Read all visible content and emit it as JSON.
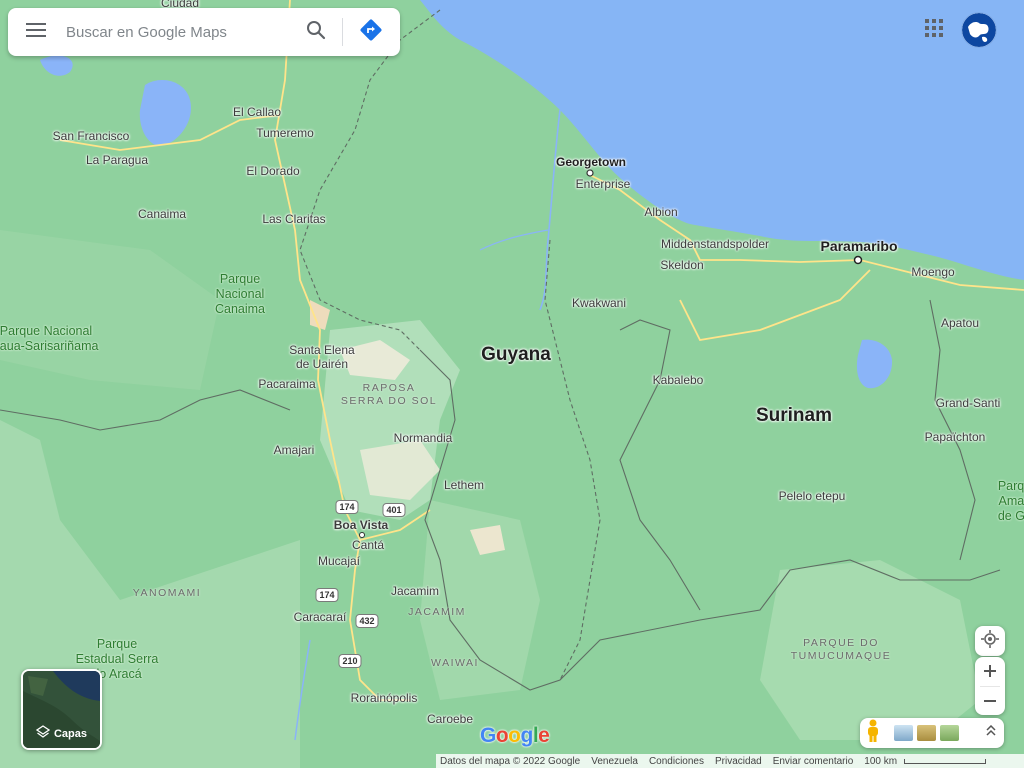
{
  "search": {
    "placeholder": "Buscar en Google Maps"
  },
  "icons": {
    "menu": "menu-icon",
    "search": "search-icon",
    "directions": "directions-icon",
    "apps": "apps-grid-icon",
    "locate": "my-location-icon",
    "pegman": "pegman-icon",
    "layers": "layers-icon",
    "expand": "chevron-up-icon"
  },
  "colors": {
    "land": "#8fd19e",
    "park": "#a8dbb0",
    "ocean": "#86b5f5",
    "water": "#8ab4f8",
    "road": "#ffe48a",
    "border": "#5f6d63"
  },
  "map": {
    "countries": [
      {
        "name": "Guyana"
      },
      {
        "name": "Surinam"
      }
    ],
    "cities": [
      {
        "name": "Georgetown"
      },
      {
        "name": "Paramaribo"
      }
    ],
    "towns": [
      "Ciudad",
      "El Callao",
      "Tumeremo",
      "San Francisco",
      "La Paragua",
      "El Dorado",
      "Canaima",
      "Las Claritas",
      "Santa Elena",
      "de Uairén",
      "Pacaraima",
      "Amajari",
      "Normandia",
      "Lethem",
      "Boa Vista",
      "Cantá",
      "Mucajaí",
      "Jacamim",
      "Caracaraí",
      "Rorainópolis",
      "Caroebe",
      "Enterprise",
      "Albion",
      "Middenstandspolder",
      "Skeldon",
      "Kwakwani",
      "Kabalebo",
      "Moengo",
      "Apatou",
      "Grand-Santi",
      "Papaïchton",
      "Pelelo etepu"
    ],
    "parks": [
      "Parque\nNacional\nCanaima",
      "Parque Nacional\nJaua-Sarisariñama",
      "Parque\nEstadual Serra\ndo Aracá",
      "Parque\nAmazo\nde Guy"
    ],
    "regions": [
      "RAPOSA\nSERRA DO SOL",
      "YANOMAMI",
      "JACAMIM",
      "WAIWAI",
      "PARQUE DO\nTUMUCUMAQUE"
    ],
    "road_shields": [
      "174",
      "401",
      "174",
      "432",
      "210"
    ]
  },
  "layers": {
    "label": "Capas"
  },
  "logo": "Google",
  "footer": {
    "data": "Datos del mapa © 2022 Google",
    "country": "Venezuela",
    "terms": "Condiciones",
    "privacy": "Privacidad",
    "feedback": "Enviar comentario",
    "scale": "100 km"
  }
}
